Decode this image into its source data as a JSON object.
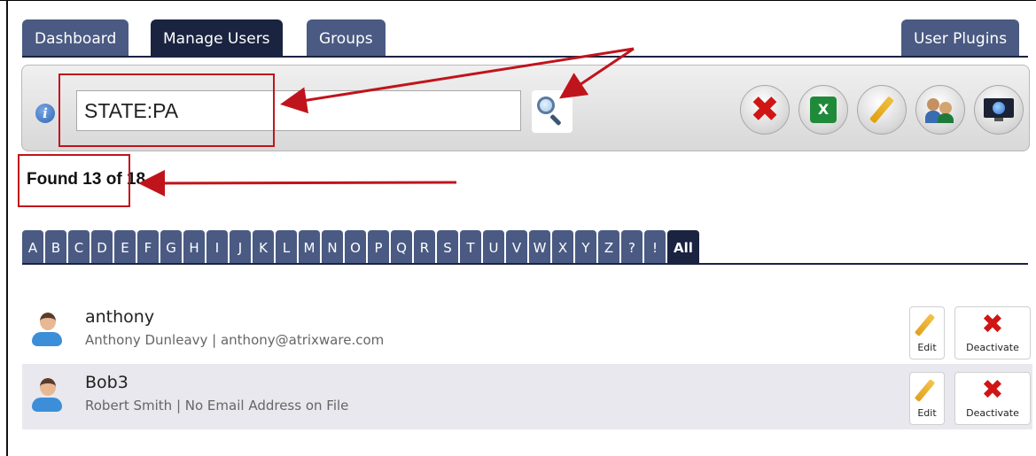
{
  "tabs": {
    "dashboard": "Dashboard",
    "manage_users": "Manage Users",
    "groups": "Groups",
    "user_plugins": "User Plugins"
  },
  "toolbar": {
    "info_icon": "i",
    "search_value": "STATE:PA",
    "icons": [
      "search-icon",
      "delete-icon",
      "excel-export-icon",
      "edit-icon",
      "groups-icon",
      "web-icon"
    ],
    "excel_glyph": "X"
  },
  "results": {
    "found_text": "Found 13 of 18"
  },
  "alphabet": [
    "A",
    "B",
    "C",
    "D",
    "E",
    "F",
    "G",
    "H",
    "I",
    "J",
    "K",
    "L",
    "M",
    "N",
    "O",
    "P",
    "Q",
    "R",
    "S",
    "T",
    "U",
    "V",
    "W",
    "X",
    "Y",
    "Z",
    "?",
    "!",
    "All"
  ],
  "alphabet_selected": "All",
  "users": [
    {
      "username": "anthony",
      "details": "Anthony Dunleavy | anthony@atrixware.com",
      "edit_label": "Edit",
      "deactivate_label": "Deactivate"
    },
    {
      "username": "Bob3",
      "details": "Robert Smith | No Email Address on File",
      "edit_label": "Edit",
      "deactivate_label": "Deactivate"
    }
  ],
  "colors": {
    "tab": "#4a5a82",
    "tab_active": "#1a2340",
    "annotation": "#c0141c",
    "delete": "#d01515"
  }
}
